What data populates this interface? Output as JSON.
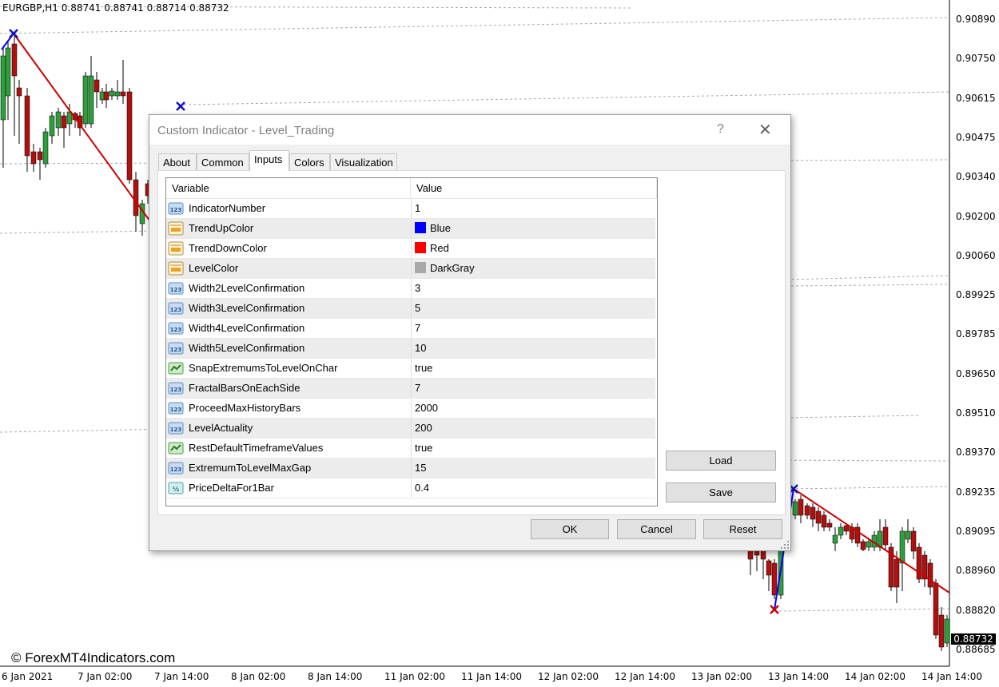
{
  "chart": {
    "header": "EURGBP,H1  0.88741 0.88741 0.88714 0.88732",
    "price_labels": [
      "0.90890",
      "0.90750",
      "0.90615",
      "0.90475",
      "0.90340",
      "0.90200",
      "0.90060",
      "0.89925",
      "0.89785",
      "0.89650",
      "0.89510",
      "0.89370",
      "0.89235",
      "0.89095",
      "0.88960",
      "0.88820",
      "0.88685"
    ],
    "time_labels": [
      "6 Jan 2021",
      "7 Jan 02:00",
      "7 Jan 14:00",
      "8 Jan 02:00",
      "8 Jan 14:00",
      "11 Jan 02:00",
      "11 Jan 14:00",
      "12 Jan 02:00",
      "12 Jan 14:00",
      "13 Jan 02:00",
      "13 Jan 14:00",
      "14 Jan 02:00",
      "14 Jan 14:00"
    ],
    "current_price": "0.88732",
    "watermark": "© ForexMT4Indicators.com",
    "colors": {
      "bull": "#2e9e3e",
      "bear": "#b01010",
      "trend_up": "#0000ff",
      "trend_down": "#cc0000",
      "level": "#a9a9a9"
    }
  },
  "dialog": {
    "title": "Custom Indicator - Level_Trading",
    "help_label": "?",
    "close_label": "✕",
    "tabs": [
      {
        "label": "About"
      },
      {
        "label": "Common"
      },
      {
        "label": "Inputs",
        "active": true
      },
      {
        "label": "Colors"
      },
      {
        "label": "Visualization"
      }
    ],
    "grid": {
      "col_variable": "Variable",
      "col_value": "Value",
      "rows": [
        {
          "name": "IndicatorNumber",
          "value": "1",
          "icon": "int-icon"
        },
        {
          "name": "TrendUpColor",
          "value": "Blue",
          "icon": "color-icon",
          "swatch": "#0000ff"
        },
        {
          "name": "TrendDownColor",
          "value": "Red",
          "icon": "color-icon",
          "swatch": "#ff0000"
        },
        {
          "name": "LevelColor",
          "value": "DarkGray",
          "icon": "color-icon",
          "swatch": "#a9a9a9"
        },
        {
          "name": "Width2LevelConfirmation",
          "value": "3",
          "icon": "int-icon"
        },
        {
          "name": "Width3LevelConfirmation",
          "value": "5",
          "icon": "int-icon"
        },
        {
          "name": "Width4LevelConfirmation",
          "value": "7",
          "icon": "int-icon"
        },
        {
          "name": "Width5LevelConfirmation",
          "value": "10",
          "icon": "int-icon"
        },
        {
          "name": "SnapExtremumsToLevelOnChar",
          "value": "true",
          "icon": "bool-icon"
        },
        {
          "name": "FractalBarsOnEachSide",
          "value": "7",
          "icon": "int-icon"
        },
        {
          "name": "ProceedMaxHistoryBars",
          "value": "2000",
          "icon": "int-icon"
        },
        {
          "name": "LevelActuality",
          "value": "200",
          "icon": "int-icon"
        },
        {
          "name": "RestDefaultTimeframeValues",
          "value": "true",
          "icon": "bool-icon"
        },
        {
          "name": "ExtremumToLevelMaxGap",
          "value": "15",
          "icon": "int-icon"
        },
        {
          "name": "PriceDeltaFor1Bar",
          "value": "0.4",
          "icon": "double-icon"
        }
      ]
    },
    "buttons": {
      "load": "Load",
      "save": "Save",
      "ok": "OK",
      "cancel": "Cancel",
      "reset": "Reset"
    }
  }
}
